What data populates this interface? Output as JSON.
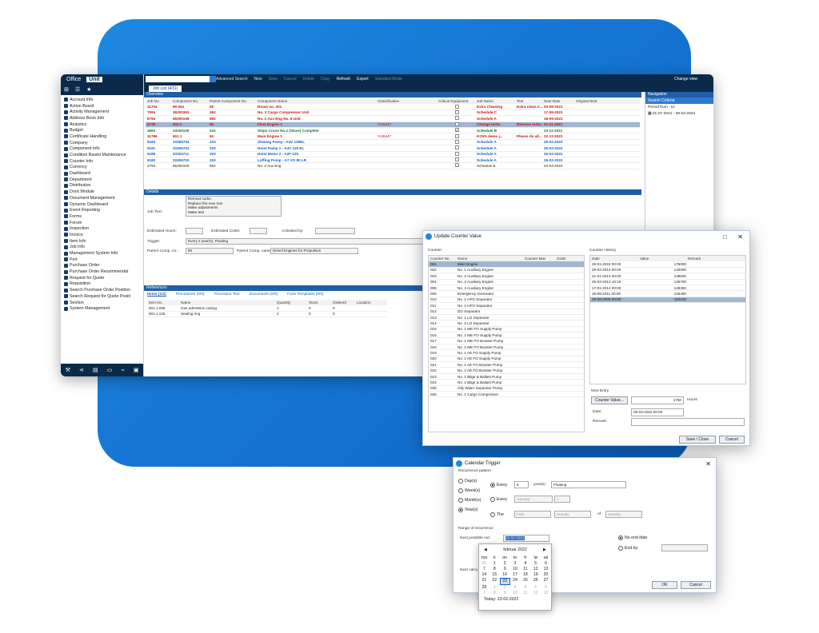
{
  "sidebar": {
    "tabs": [
      "Office",
      "Unit"
    ],
    "items": [
      "Account Info",
      "Action Board",
      "Activity Management",
      "Address Book Info",
      "Analytics",
      "Budget",
      "Certificate Handling",
      "Company",
      "Component Info",
      "Condition Based Maintenance",
      "Counter Info",
      "Currency",
      "Dashboard",
      "Department",
      "Distribution",
      "Dock Module",
      "Document Management",
      "Dynamic Dashboard",
      "Event Reporting",
      "Forms",
      "Forum",
      "Inspection",
      "Invoice",
      "Item Info",
      "Job Info",
      "Management System Info",
      "Port",
      "Purchase Order",
      "Purchase Order Recommendat",
      "Request for Quote",
      "Requisition",
      "Search Purchase Order Position",
      "Search Request for Quote Positi",
      "Section",
      "System Management"
    ]
  },
  "toolbar": {
    "items": [
      "Advanced Search",
      "New",
      "Save",
      "Cancel",
      "Delete",
      "Copy",
      "Refresh",
      "Export",
      "Standard Mode",
      "Change view"
    ]
  },
  "tab": "Job List (4/11)",
  "overview": {
    "title": "Overview",
    "columns": [
      "Job No.",
      "Component No.",
      "Parent Component No.",
      "Component Name",
      "Classification",
      "Critical Equipment",
      "Job Name",
      "Text",
      "Next Date",
      "Original Next"
    ],
    "rows": [
      {
        "no": "11704",
        "comp": "90-051",
        "parent": "90",
        "name": "Room no. 201",
        "cls": "",
        "crit": false,
        "job": "Extra Cleaning",
        "text": "Extra clean o...",
        "next": "03-08-2021",
        "color": "red"
      },
      {
        "no": "7064",
        "comp": "36200363",
        "parent": "362",
        "name": "No. 3 Cargo Compressor Unit",
        "cls": "",
        "crit": false,
        "job": "Schedule C",
        "text": "",
        "next": "17-09-2021",
        "color": "red"
      },
      {
        "no": "8794",
        "comp": "65200108",
        "parent": "652",
        "name": "No. 2 Aux Eng No. 8 Unit",
        "cls": "",
        "crit": false,
        "job": "Schedule A",
        "text": "",
        "next": "18-09-2021",
        "color": "red"
      },
      {
        "no": "6738",
        "comp": "602.1",
        "parent": "60",
        "name": "Flow Engine 1",
        "cls": "YUB447",
        "crit": false,
        "job": "Change turbo",
        "text": "Remove turbo",
        "next": "01-11-2021",
        "color": "red",
        "sel": true
      },
      {
        "no": "4693",
        "comp": "33200100",
        "parent": "332",
        "name": "Ships Crane No.2 (Slave) Complete",
        "cls": "",
        "crit": true,
        "job": "Schedule B",
        "text": "",
        "next": "23-11-2021",
        "color": "green"
      },
      {
        "no": "11786",
        "comp": "601.1",
        "parent": "60",
        "name": "Main Engine 1",
        "cls": "YUB447",
        "crit": false,
        "job": "KOVA demo j...",
        "text": "Please do all...",
        "next": "22-12-2021",
        "color": "red"
      },
      {
        "no": "5183",
        "comp": "33306704",
        "parent": "333",
        "name": "Slewing Pump - A4V 125EL",
        "cls": "",
        "crit": false,
        "job": "Schedule A",
        "text": "",
        "next": "26-02-2022",
        "color": "blue"
      },
      {
        "no": "5181",
        "comp": "33306701",
        "parent": "333",
        "name": "Hoist Pump 1 - A4V 125 EL",
        "cls": "",
        "crit": false,
        "job": "Schedule A",
        "text": "",
        "next": "26-02-2022",
        "color": "blue"
      },
      {
        "no": "5186",
        "comp": "33304711",
        "parent": "333",
        "name": "Hoist Motor 2 - A2F 125",
        "cls": "",
        "crit": false,
        "job": "Schedule A",
        "text": "",
        "next": "26-02-2022",
        "color": "blue"
      },
      {
        "no": "5182",
        "comp": "33306703",
        "parent": "333",
        "name": "Luffing Pump - A7 VO 80 LR",
        "cls": "",
        "crit": false,
        "job": "Schedule A",
        "text": "",
        "next": "26-02-2022",
        "color": "blue"
      },
      {
        "no": "4794",
        "comp": "65200100",
        "parent": "652",
        "name": "No. 2 Aux Eng",
        "cls": "",
        "crit": false,
        "job": "Schedule B",
        "text": "",
        "next": "24-04-2022",
        "color": "plain"
      }
    ]
  },
  "navigation": {
    "title": "Navigation",
    "search": "Search Criteria",
    "period_label": "Period from - to:",
    "period": "01-07-2021 - 09-03-2024"
  },
  "details": {
    "title": "Details",
    "job_text": "Remove turbo\nReplace the new one\nMake adjustments\nMake test",
    "job_text_label": "Job Text:",
    "est_hours": "Estimated Hours:",
    "est_costs": "Estimated Costs:",
    "activated": "Activated by:",
    "trigger_label": "Trigger:",
    "trigger": "Every 2 year(s), Floating",
    "parent_no_label": "Parent Comp. no.:",
    "parent_no": "60",
    "parent_name_label": "Parent Comp. name:",
    "parent_name": "Diesel Engines for Propulsion"
  },
  "references": {
    "title": "References",
    "tabs": [
      "Items (1/2)",
      "Procedures (0/0)",
      "Procedure Text",
      "Documents (0/0)",
      "Form Templates (0/0)"
    ],
    "columns": [
      "Item No.",
      "Name",
      "Quantity",
      "Stock",
      "Ordered",
      "Location"
    ],
    "rows": [
      [
        "601.1.055",
        "Gas admission casing",
        "1",
        "0",
        "0",
        ""
      ],
      [
        "601.1.125",
        "Sealing ring",
        "2",
        "0",
        "0",
        ""
      ]
    ]
  },
  "counter": {
    "title": "Update Counter Value",
    "counter_label": "Counter:",
    "columns": [
      "Counter No.",
      "Name",
      "Counter Max",
      "Order"
    ],
    "rows": [
      [
        "001",
        "Main Engine"
      ],
      [
        "002",
        "No. 1 Auxiliary Engine"
      ],
      [
        "003",
        "No. 2 Auxiliary Engine"
      ],
      [
        "004",
        "No. 3 Auxiliary Engine"
      ],
      [
        "005",
        "No. 4 Auxiliary Engine"
      ],
      [
        "006",
        "Emergency Generator"
      ],
      [
        "010",
        "No. 1 HFO Separator"
      ],
      [
        "011",
        "No. 2 HFO Separator"
      ],
      [
        "012",
        "DO Separator"
      ],
      [
        "013",
        "No. 1 LO Separator"
      ],
      [
        "014",
        "No. 2 LO Separator"
      ],
      [
        "015",
        "No. 1 ME FO Supply Pump"
      ],
      [
        "016",
        "No. 2 ME FO Supply Pump"
      ],
      [
        "017",
        "No. 1 ME FO Booster Pump"
      ],
      [
        "018",
        "No. 2 ME FO Booster Pump"
      ],
      [
        "019",
        "No. 1 AE FO Supply Pump"
      ],
      [
        "020",
        "No. 2 AE FO Supply Pump"
      ],
      [
        "021",
        "No. 1 AE FO Booster Pump"
      ],
      [
        "022",
        "No. 2 AE FO Booster Pump"
      ],
      [
        "023",
        "No. 1 Bilge & Ballast Pump"
      ],
      [
        "024",
        "No. 2 Bilge & Ballast Pump"
      ],
      [
        "025",
        "Oily Water Separator Pump"
      ],
      [
        "026",
        "No. 1 Cargo Compressor"
      ]
    ],
    "history_label": "Counter History",
    "history_columns": [
      "Date",
      "Value",
      "Remark"
    ],
    "history": [
      [
        "26-01-2022 00:00",
        "175000"
      ],
      [
        "28-02-2014 00:00",
        "140000"
      ],
      [
        "21-01-2014 00:00",
        "138500"
      ],
      [
        "25-03-2012 10:15",
        "135700"
      ],
      [
        "17-01-2012 00:00",
        "128350"
      ],
      [
        "19-08-2011 00:00",
        "125400"
      ],
      [
        "19-08-2009 00:00",
        "110232"
      ]
    ],
    "new_entry": "New Entry",
    "counter_value_btn": "Counter Value...",
    "value": "1750",
    "hours": "Hours",
    "date_label": "Date:",
    "date": "09-03-2022 00:00",
    "remark": "Remark:",
    "save": "Save / Close",
    "cancel": "Cancel"
  },
  "trigger": {
    "title": "Calendar Trigger",
    "pattern": "Recurrence pattern",
    "options": [
      "Day(s)",
      "Week(s)",
      "Month(s)",
      "Year(s)"
    ],
    "every": "Every",
    "num": "5",
    "unit": "year(s)",
    "mode": "Floating",
    "every2": "Every",
    "month": "January",
    "day": "1",
    "the": "The",
    "first": "First",
    "weekday": "Sunday",
    "of": "of",
    "month2": "January",
    "range": "Range of recurrence",
    "next_run": "Next possible run:",
    "next_val": "23-02-2022",
    "no_end": "No end date",
    "end_by": "End by:",
    "next_calc": "Next calcu",
    "ok": "OK",
    "cancel": "Cancel"
  },
  "calendar": {
    "month": "februar 2022",
    "days": [
      "ma",
      "ti",
      "on",
      "to",
      "fr",
      "lø",
      "sø"
    ],
    "weeks": [
      [
        "31",
        "1",
        "2",
        "3",
        "4",
        "5",
        "6"
      ],
      [
        "7",
        "8",
        "9",
        "10",
        "11",
        "12",
        "13"
      ],
      [
        "14",
        "15",
        "16",
        "17",
        "18",
        "19",
        "20"
      ],
      [
        "21",
        "22",
        "23",
        "24",
        "25",
        "26",
        "27"
      ],
      [
        "28",
        "1",
        "2",
        "3",
        "4",
        "5",
        "6"
      ],
      [
        "7",
        "8",
        "9",
        "10",
        "11",
        "12",
        "13"
      ]
    ],
    "today": "Today: 23-02-2022"
  }
}
